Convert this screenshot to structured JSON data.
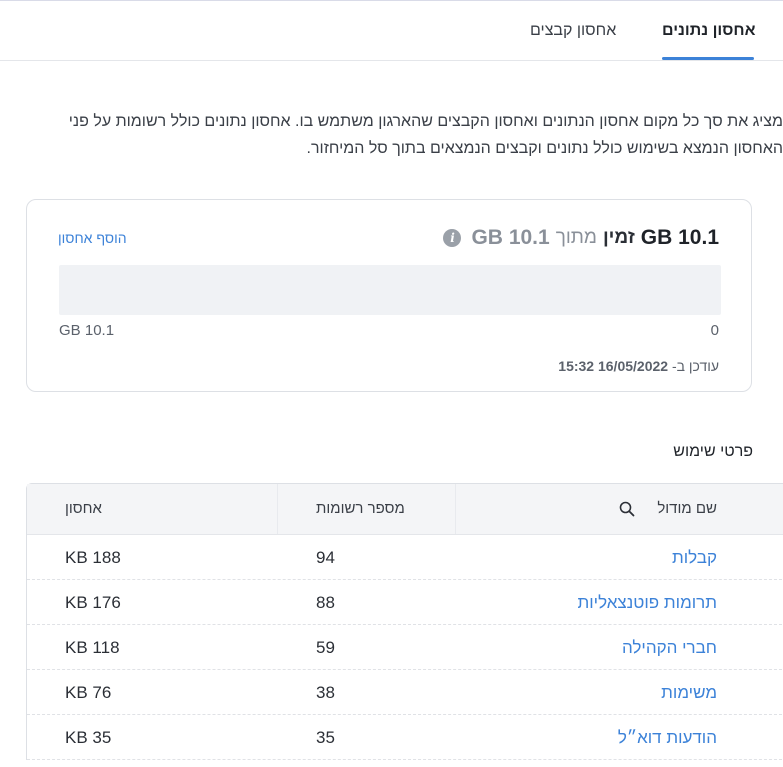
{
  "tabs": [
    {
      "label": "אחסון נתונים",
      "active": true
    },
    {
      "label": "אחסון קבצים",
      "active": false
    }
  ],
  "description": {
    "line1": "מציג את סך כל מקום אחסון הנתונים ואחסון הקבצים שהארגון משתמש בו. אחסון נתונים כולל רשומות על פני",
    "line2": "האחסון הנמצא בשימוש כולל נתונים וקבצים הנמצאים בתוך סל המיחזור."
  },
  "usage_card": {
    "used": "10.1 GB",
    "available_word": "זמין",
    "of_word": "מתוך",
    "total": "10.1 GB",
    "info_icon": "info-icon",
    "add_storage_link": "הוסף אחסון",
    "bar_fill_fraction": 0,
    "bar_min_label": "0",
    "bar_max_label": "10.1 GB",
    "updated_label": "עודכן ב-",
    "updated_value": "16/05/2022 15:32"
  },
  "usage_details": {
    "title": "פרטי שימוש",
    "columns": {
      "module": "שם מודול",
      "records": "מספר רשומות",
      "storage": "אחסון"
    },
    "search_icon": "search-icon",
    "rows": [
      {
        "module": "קבלות",
        "records": "94",
        "storage": "188 KB"
      },
      {
        "module": "תרומות פוטנצאליות",
        "records": "88",
        "storage": "176 KB"
      },
      {
        "module": "חברי הקהילה",
        "records": "59",
        "storage": "118 KB"
      },
      {
        "module": "משימות",
        "records": "38",
        "storage": "76 KB"
      },
      {
        "module": "הודעות דוא״ל",
        "records": "35",
        "storage": "35 KB"
      }
    ]
  },
  "colors": {
    "accent": "#3c82d8",
    "bar_track": "#f0f2f5",
    "muted_text": "#8a9099"
  }
}
